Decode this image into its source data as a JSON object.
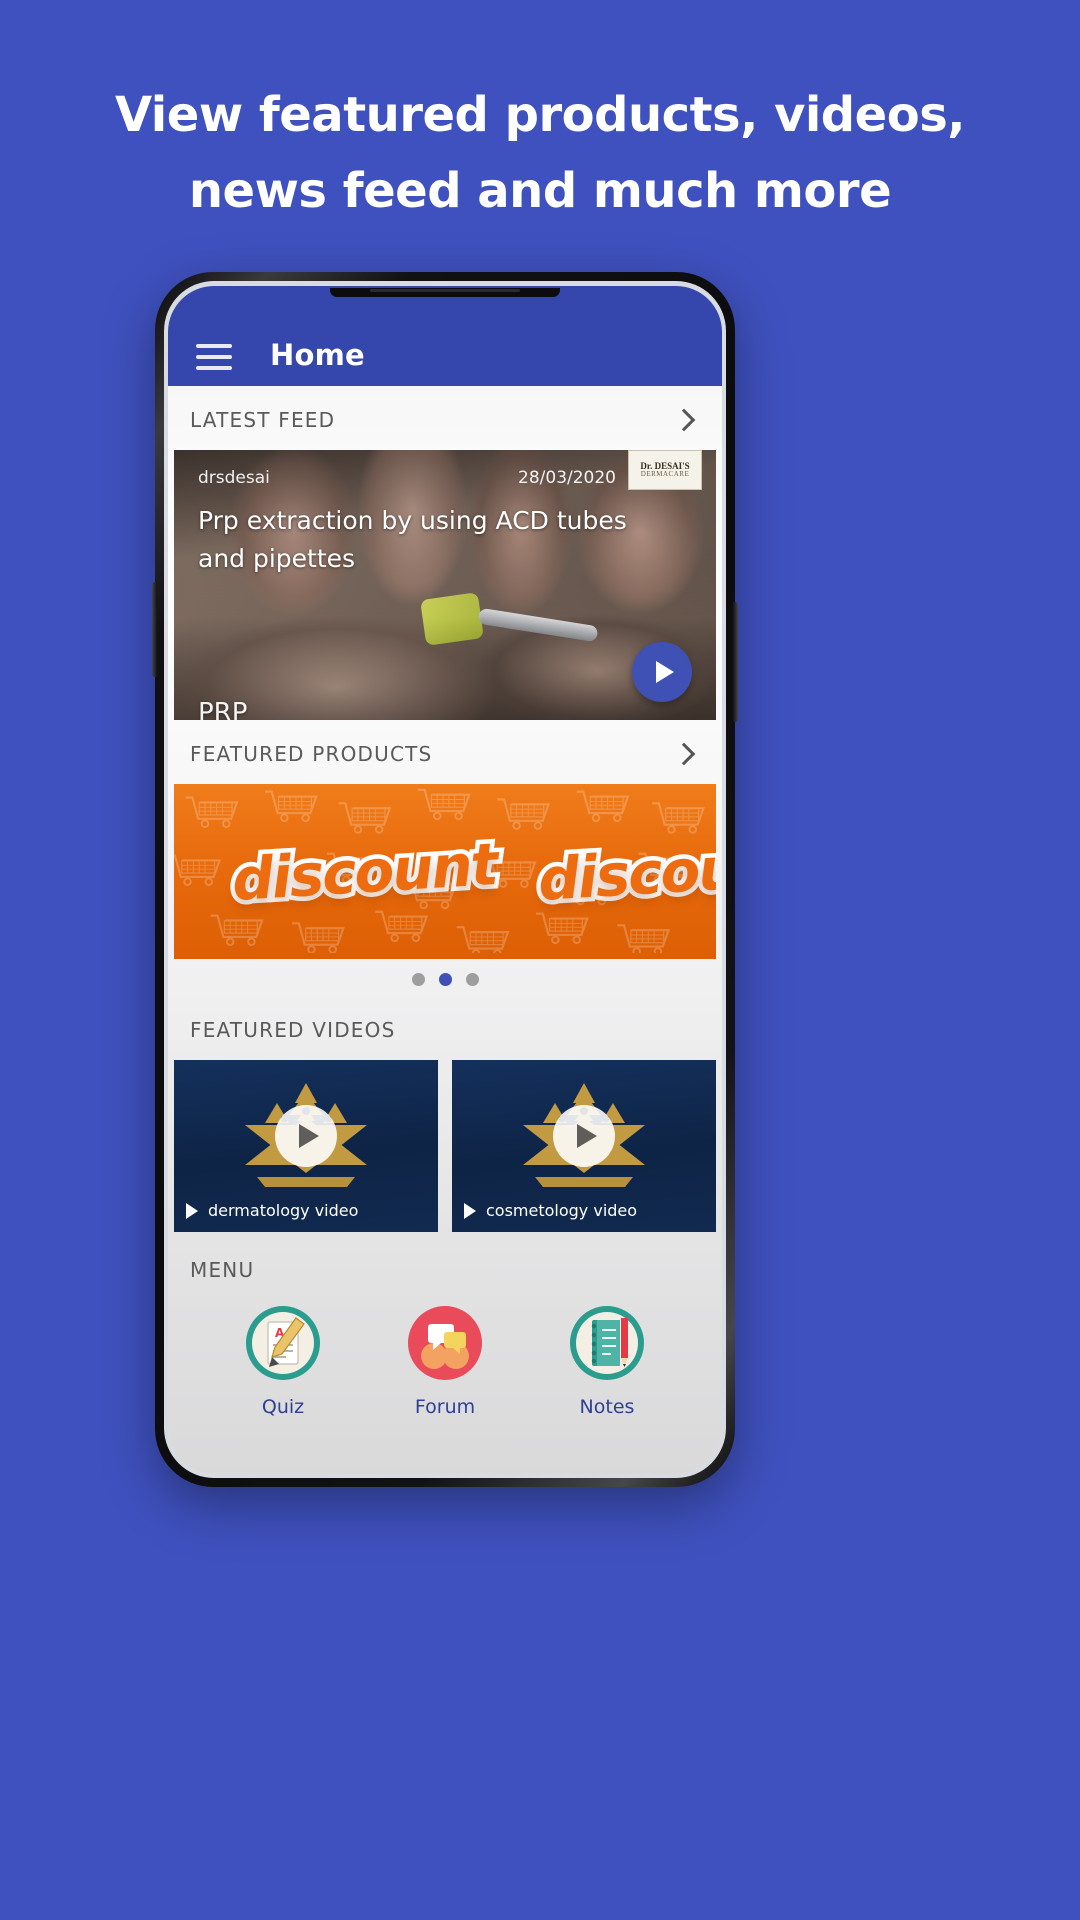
{
  "promo": {
    "headline_line1": "View featured products, videos,",
    "headline_line2": "news feed and much more",
    "background_color": "#3F51BF"
  },
  "appbar": {
    "menu_icon": "hamburger-menu-icon",
    "title": "Home",
    "background_color": "#3546AC"
  },
  "sections": {
    "latest_feed": {
      "title": "LATEST FEED",
      "chevron_icon": "chevron-right-icon"
    },
    "featured_products": {
      "title": "FEATURED PRODUCTS",
      "chevron_icon": "chevron-right-icon"
    },
    "featured_videos": {
      "title": "FEATURED VIDEOS"
    },
    "menu": {
      "title": "MENU"
    }
  },
  "feed_card": {
    "username": "drsdesai",
    "date": "28/03/2020",
    "title": "Prp extraction by using ACD tubes and pipettes",
    "partial_text_below": "PRP",
    "logo_line1": "Dr. DESAI'S",
    "logo_line2": "DERMACARE",
    "play_icon": "play-icon",
    "play_button_color": "#3F51B5"
  },
  "products_carousel": {
    "banner_word_1": "discount",
    "banner_word_2": "discount",
    "banner_color": "#E76A0C",
    "dots": [
      {
        "active": false
      },
      {
        "active": true
      },
      {
        "active": false
      }
    ],
    "active_index": 1
  },
  "featured_videos": [
    {
      "label": "dermatology video",
      "play_icon": "play-icon",
      "small_play_icon": "play-icon"
    },
    {
      "label": "cosmetology video",
      "play_icon": "play-icon",
      "small_play_icon": "play-icon"
    }
  ],
  "menu_items": [
    {
      "label": "Quiz",
      "icon": "quiz-document-icon",
      "color": "#2A9D8F"
    },
    {
      "label": "Forum",
      "icon": "forum-chat-icon",
      "color": "#E94B5A"
    },
    {
      "label": "Notes",
      "icon": "notes-notebook-icon",
      "color": "#2A9D8F"
    }
  ]
}
